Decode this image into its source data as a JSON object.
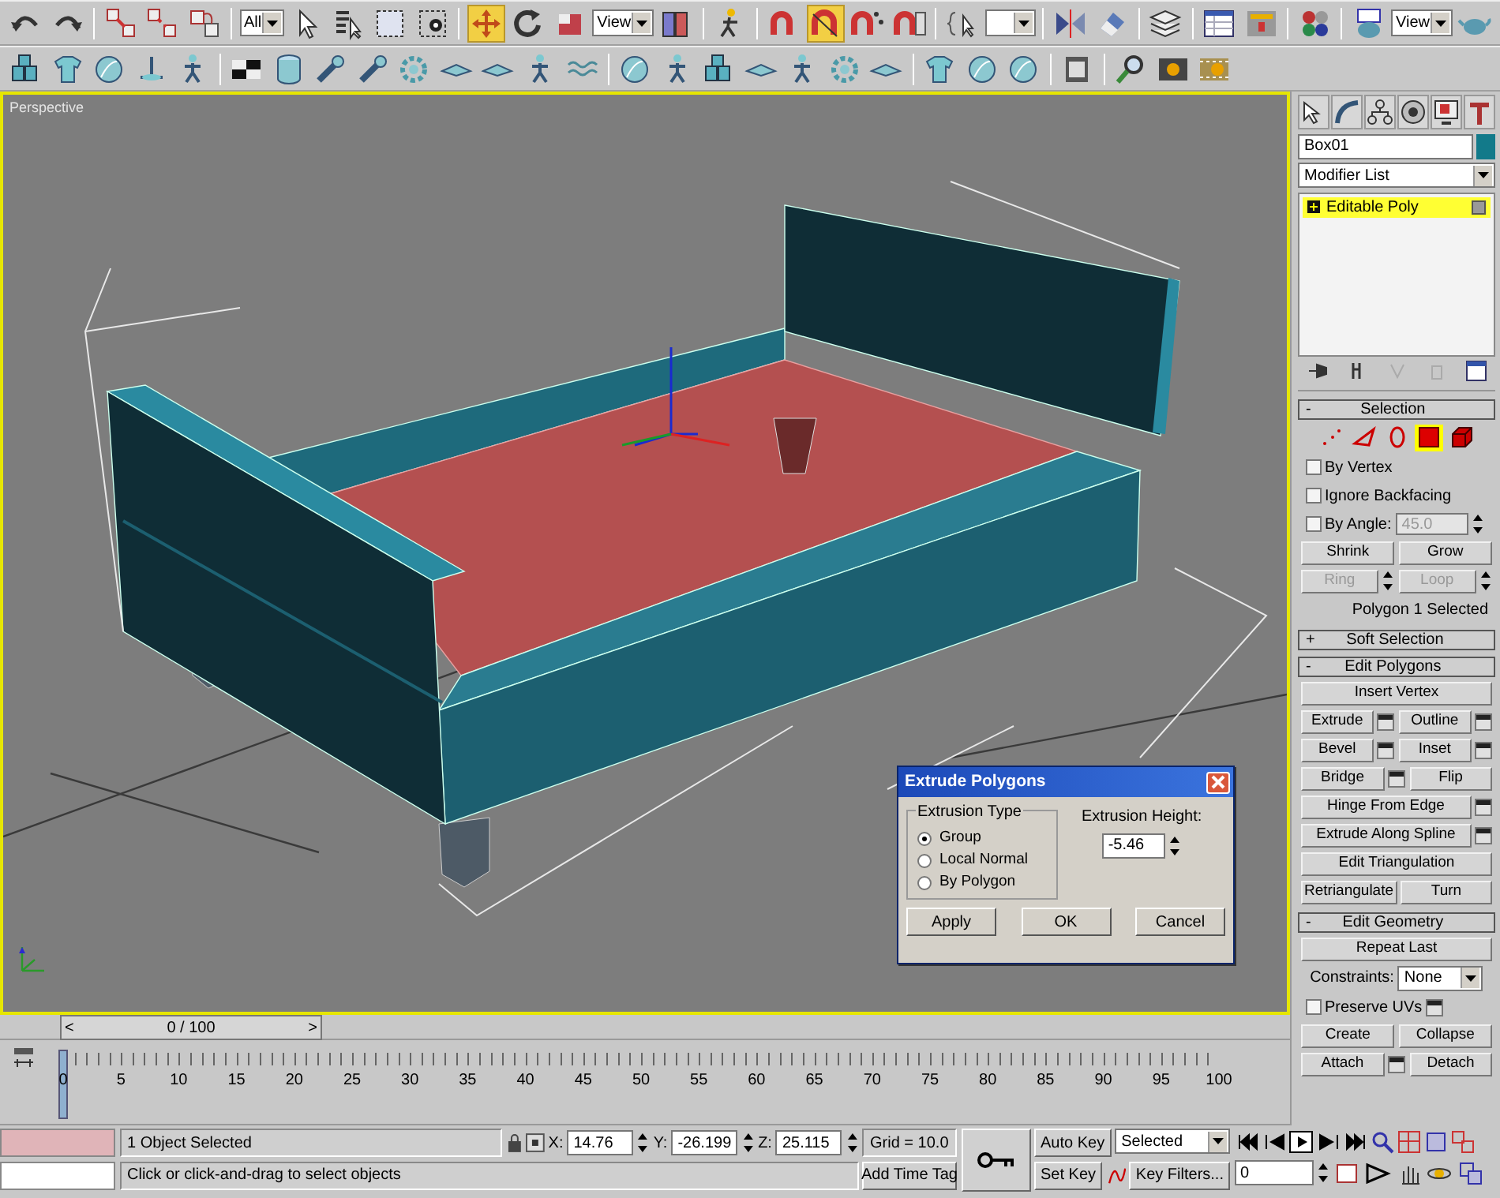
{
  "main_toolbar": [
    {
      "kind": "tool",
      "selected": false
    },
    {
      "kind": "tool",
      "selected": false
    },
    {
      "kind": "sep"
    },
    {
      "kind": "tool",
      "selected": false
    },
    {
      "kind": "tool",
      "selected": false
    },
    {
      "kind": "tool",
      "selected": false
    },
    {
      "kind": "sep"
    },
    {
      "kind": "dropdown",
      "value": "All"
    },
    {
      "kind": "tool",
      "selected": false
    },
    {
      "kind": "tool",
      "selected": false
    },
    {
      "kind": "tool",
      "selected": false
    },
    {
      "kind": "tool",
      "selected": false
    },
    {
      "kind": "sep"
    },
    {
      "kind": "tool",
      "selected": true
    },
    {
      "kind": "tool",
      "selected": false
    },
    {
      "kind": "tool",
      "selected": false
    },
    {
      "kind": "dropdown",
      "value": "View"
    },
    {
      "kind": "tool",
      "selected": false
    },
    {
      "kind": "sep"
    },
    {
      "kind": "tool",
      "selected": false
    },
    {
      "kind": "sep"
    },
    {
      "kind": "tool",
      "selected": false
    },
    {
      "kind": "tool",
      "selected": true
    },
    {
      "kind": "tool",
      "selected": false
    },
    {
      "kind": "tool",
      "selected": false
    },
    {
      "kind": "sep"
    },
    {
      "kind": "tool",
      "selected": false
    },
    {
      "kind": "dropdown"
    },
    {
      "kind": "sep"
    },
    {
      "kind": "tool",
      "selected": false
    },
    {
      "kind": "tool",
      "selected": false
    },
    {
      "kind": "sep"
    },
    {
      "kind": "tool",
      "selected": false
    },
    {
      "kind": "sep"
    },
    {
      "kind": "tool",
      "selected": false
    },
    {
      "kind": "tool",
      "selected": false
    },
    {
      "kind": "sep"
    },
    {
      "kind": "tool",
      "selected": false
    },
    {
      "kind": "sep"
    },
    {
      "kind": "tool",
      "selected": false
    },
    {
      "kind": "dropdown",
      "value": "View"
    },
    {
      "kind": "tool",
      "selected": false
    }
  ],
  "viewport": {
    "label": "Perspective"
  },
  "dialog": {
    "title": "Extrude Polygons",
    "group_title": "Extrusion Type",
    "options": [
      {
        "label": "Group",
        "selected": true
      },
      {
        "label": "Local Normal",
        "selected": false
      },
      {
        "label": "By Polygon",
        "selected": false
      }
    ],
    "height_label": "Extrusion Height:",
    "height_value": "-5.46",
    "buttons": [
      "Apply",
      "OK",
      "Cancel"
    ]
  },
  "command_panel": {
    "object_name": "Box01",
    "modifier_list": "Modifier List",
    "stack": [
      {
        "label": "Editable Poly",
        "selected": true
      }
    ],
    "rollouts": [
      {
        "toggle": "-",
        "title": "Selection",
        "rows": [
          {
            "kind": "levels",
            "levels": [
              {
                "selected": false
              },
              {
                "selected": false
              },
              {
                "selected": false
              },
              {
                "selected": true
              },
              {
                "selected": false
              }
            ]
          },
          {
            "kind": "check",
            "label": "By Vertex",
            "checked": false
          },
          {
            "kind": "check",
            "label": "Ignore Backfacing",
            "checked": false
          },
          {
            "kind": "check",
            "label": "By Angle:",
            "checked": false,
            "value": "45.0",
            "disabled": true
          },
          {
            "kind": "buttons",
            "buttons": [
              {
                "label": "Shrink",
                "disabled": false
              },
              {
                "label": "Grow",
                "disabled": false
              }
            ]
          },
          {
            "kind": "spinbuttons",
            "buttons": [
              {
                "label": "Ring",
                "disabled": true
              },
              {
                "label": "Loop",
                "disabled": true
              }
            ]
          },
          {
            "kind": "note",
            "text": "Polygon 1 Selected"
          }
        ]
      },
      {
        "toggle": "+",
        "title": "Soft Selection"
      },
      {
        "toggle": "-",
        "title": "Edit Polygons",
        "rows": [
          {
            "kind": "buttons",
            "buttons": [
              {
                "label": "Insert Vertex",
                "settings": false
              }
            ]
          },
          {
            "kind": "buttons",
            "buttons": [
              {
                "label": "Extrude",
                "settings": true
              },
              {
                "label": "Outline",
                "settings": true
              }
            ]
          },
          {
            "kind": "buttons",
            "buttons": [
              {
                "label": "Bevel",
                "settings": true
              },
              {
                "label": "Inset",
                "settings": true
              }
            ]
          },
          {
            "kind": "buttons",
            "buttons": [
              {
                "label": "Bridge",
                "settings": true
              },
              {
                "label": "Flip",
                "settings": false
              }
            ]
          },
          {
            "kind": "buttons",
            "buttons": [
              {
                "label": "Hinge From Edge",
                "settings": true
              }
            ]
          },
          {
            "kind": "buttons",
            "buttons": [
              {
                "label": "Extrude Along Spline",
                "settings": true
              }
            ]
          },
          {
            "kind": "buttons",
            "buttons": [
              {
                "label": "Edit Triangulation",
                "settings": false
              }
            ]
          },
          {
            "kind": "buttons",
            "buttons": [
              {
                "label": "Retriangulate",
                "settings": false
              },
              {
                "label": "Turn",
                "settings": false
              }
            ]
          }
        ]
      },
      {
        "toggle": "-",
        "title": "Edit Geometry",
        "rows": [
          {
            "kind": "buttons",
            "buttons": [
              {
                "label": "Repeat Last",
                "settings": false
              }
            ]
          },
          {
            "kind": "select",
            "label": "Constraints:",
            "value": "None"
          },
          {
            "kind": "check",
            "label": "Preserve UVs",
            "checked": false,
            "settings": true
          },
          {
            "kind": "buttons",
            "buttons": [
              {
                "label": "Create",
                "settings": false
              },
              {
                "label": "Collapse",
                "settings": false
              }
            ]
          },
          {
            "kind": "buttons",
            "buttons": [
              {
                "label": "Attach",
                "settings": true
              },
              {
                "label": "Detach",
                "settings": false
              }
            ]
          }
        ]
      }
    ]
  },
  "time_slider": {
    "prev": "<",
    "next": ">",
    "text": "0 / 100"
  },
  "track_bar": {
    "ticks": [
      "0",
      "5",
      "10",
      "15",
      "20",
      "25",
      "30",
      "35",
      "40",
      "45",
      "50",
      "55",
      "60",
      "65",
      "70",
      "75",
      "80",
      "85",
      "90",
      "95",
      "100"
    ],
    "level": 0
  },
  "status_bar": {
    "selection": "1 Object Selected",
    "prompt": "Click or click-and-drag to select objects",
    "coords": [
      {
        "label": "X:",
        "value": "14.76"
      },
      {
        "label": "Y:",
        "value": "-26.199"
      },
      {
        "label": "Z:",
        "value": "25.115"
      }
    ],
    "grid": "Grid = 10.0",
    "time_tag": "Add Time Tag",
    "auto_key": "Auto Key",
    "set_key": "Set Key",
    "key_mode": "Selected",
    "key_filters": "Key Filters...",
    "frame": "0"
  }
}
